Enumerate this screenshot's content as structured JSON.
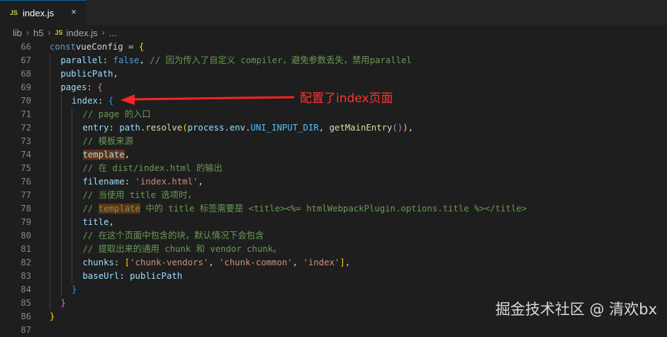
{
  "tab": {
    "icon": "JS",
    "filename": "index.js",
    "close_icon": "×"
  },
  "breadcrumb": {
    "segments": [
      "lib",
      "h5"
    ],
    "file_icon": "JS",
    "file": "index.js",
    "more": "..."
  },
  "annotation": {
    "text": "配置了index页面"
  },
  "watermark": {
    "text": "掘金技术社区 @ 清欢bx"
  },
  "lines": [
    {
      "num": "66",
      "indent": 0,
      "tokens": [
        [
          "k",
          "const"
        ],
        [
          "",
          "vueConfig = "
        ],
        [
          "br1",
          "{"
        ]
      ]
    },
    {
      "num": "67",
      "indent": 1,
      "tokens": [
        [
          "v",
          "parallel"
        ],
        [
          "",
          ": "
        ],
        [
          "b",
          "false"
        ],
        [
          "",
          ", "
        ],
        [
          "c",
          "// 因为传入了自定义 compiler，避免参数丢失，禁用parallel"
        ]
      ]
    },
    {
      "num": "68",
      "indent": 1,
      "tokens": [
        [
          "v",
          "publicPath"
        ],
        [
          "",
          ","
        ]
      ]
    },
    {
      "num": "69",
      "indent": 1,
      "tokens": [
        [
          "v",
          "pages"
        ],
        [
          "",
          ": "
        ],
        [
          "br2",
          "{"
        ]
      ]
    },
    {
      "num": "70",
      "indent": 2,
      "tokens": [
        [
          "v",
          "index"
        ],
        [
          "",
          ": "
        ],
        [
          "br3",
          "{"
        ]
      ]
    },
    {
      "num": "71",
      "indent": 3,
      "tokens": [
        [
          "c",
          "// page 的入口"
        ]
      ]
    },
    {
      "num": "72",
      "indent": 3,
      "tokens": [
        [
          "v",
          "entry"
        ],
        [
          "",
          ": "
        ],
        [
          "v",
          "path"
        ],
        [
          "",
          "."
        ],
        [
          "f",
          "resolve"
        ],
        [
          "br1",
          "("
        ],
        [
          "v",
          "process"
        ],
        [
          "",
          "."
        ],
        [
          "v",
          "env"
        ],
        [
          "",
          "."
        ],
        [
          "cst",
          "UNI_INPUT_DIR"
        ],
        [
          "",
          ", "
        ],
        [
          "f",
          "getMainEntry"
        ],
        [
          "br2",
          "()"
        ],
        [
          "br1",
          ")"
        ],
        [
          "",
          ","
        ]
      ]
    },
    {
      "num": "73",
      "indent": 3,
      "tokens": [
        [
          "c",
          "// 模板来源"
        ]
      ]
    },
    {
      "num": "74",
      "indent": 3,
      "tokens": [
        [
          "v hl",
          "template"
        ],
        [
          "",
          ","
        ]
      ]
    },
    {
      "num": "75",
      "indent": 3,
      "tokens": [
        [
          "c",
          "// 在 dist/index.html 的输出"
        ]
      ]
    },
    {
      "num": "76",
      "indent": 3,
      "tokens": [
        [
          "v",
          "filename"
        ],
        [
          "",
          ": "
        ],
        [
          "s",
          "'index.html'"
        ],
        [
          "",
          ","
        ]
      ]
    },
    {
      "num": "77",
      "indent": 3,
      "tokens": [
        [
          "c",
          "// 当使用 title 选项时，"
        ]
      ]
    },
    {
      "num": "78",
      "indent": 3,
      "tokens": [
        [
          "c",
          "// "
        ],
        [
          "c hl",
          "template"
        ],
        [
          "c",
          " 中的 title 标签需要是 <title><%= htmlWebpackPlugin.options.title %></title>"
        ]
      ]
    },
    {
      "num": "79",
      "indent": 3,
      "tokens": [
        [
          "v",
          "title"
        ],
        [
          "",
          ","
        ]
      ]
    },
    {
      "num": "80",
      "indent": 3,
      "tokens": [
        [
          "c",
          "// 在这个页面中包含的块，默认情况下会包含"
        ]
      ]
    },
    {
      "num": "81",
      "indent": 3,
      "tokens": [
        [
          "c",
          "// 提取出来的通用 chunk 和 vendor chunk。"
        ]
      ]
    },
    {
      "num": "82",
      "indent": 3,
      "tokens": [
        [
          "v",
          "chunks"
        ],
        [
          "",
          ": "
        ],
        [
          "br1",
          "["
        ],
        [
          "s",
          "'chunk-vendors'"
        ],
        [
          "",
          ", "
        ],
        [
          "s",
          "'chunk-common'"
        ],
        [
          "",
          ", "
        ],
        [
          "s",
          "'index'"
        ],
        [
          "br1",
          "]"
        ],
        [
          "",
          ","
        ]
      ]
    },
    {
      "num": "83",
      "indent": 3,
      "tokens": [
        [
          "v",
          "baseUrl"
        ],
        [
          "",
          ": "
        ],
        [
          "v",
          "publicPath"
        ]
      ]
    },
    {
      "num": "84",
      "indent": 2,
      "tokens": [
        [
          "br3",
          "}"
        ]
      ]
    },
    {
      "num": "85",
      "indent": 1,
      "tokens": [
        [
          "br2",
          "}"
        ]
      ]
    },
    {
      "num": "86",
      "indent": 0,
      "tokens": [
        [
          "br1",
          "}"
        ]
      ]
    },
    {
      "num": "87",
      "indent": 0,
      "tokens": []
    }
  ]
}
